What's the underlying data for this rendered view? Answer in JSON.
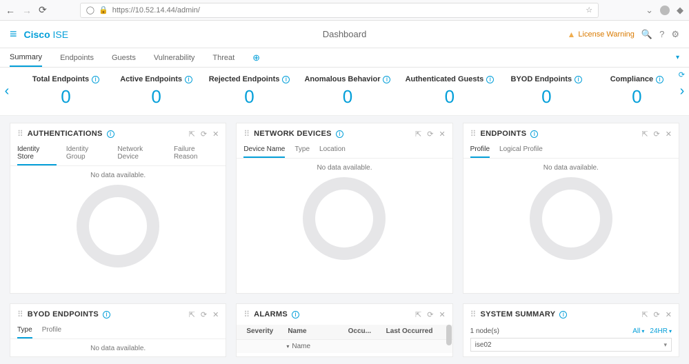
{
  "browser": {
    "url": "https://10.52.14.44/admin/"
  },
  "header": {
    "brand1": "Cisco",
    "brand2": "ISE",
    "title": "Dashboard",
    "license": "License Warning"
  },
  "tabs": {
    "items": [
      "Summary",
      "Endpoints",
      "Guests",
      "Vulnerability",
      "Threat"
    ]
  },
  "metrics": [
    {
      "label": "Total Endpoints",
      "value": "0"
    },
    {
      "label": "Active Endpoints",
      "value": "0"
    },
    {
      "label": "Rejected Endpoints",
      "value": "0"
    },
    {
      "label": "Anomalous Behavior",
      "value": "0"
    },
    {
      "label": "Authenticated Guests",
      "value": "0"
    },
    {
      "label": "BYOD Endpoints",
      "value": "0"
    },
    {
      "label": "Compliance",
      "value": "0"
    }
  ],
  "cards": {
    "auth": {
      "title": "AUTHENTICATIONS",
      "subtabs": [
        "Identity Store",
        "Identity Group",
        "Network Device",
        "Failure Reason"
      ],
      "no_data": "No data available."
    },
    "netdev": {
      "title": "NETWORK DEVICES",
      "subtabs": [
        "Device Name",
        "Type",
        "Location"
      ],
      "no_data": "No data available."
    },
    "endp": {
      "title": "ENDPOINTS",
      "subtabs": [
        "Profile",
        "Logical Profile"
      ],
      "no_data": "No data available."
    },
    "byod": {
      "title": "BYOD ENDPOINTS",
      "subtabs": [
        "Type",
        "Profile"
      ],
      "no_data": "No data available."
    },
    "alarms": {
      "title": "ALARMS",
      "cols": {
        "sev": "Severity",
        "name": "Name",
        "occ": "Occu...",
        "last": "Last Occurred"
      },
      "row_name": "Name"
    },
    "syssum": {
      "title": "SYSTEM SUMMARY",
      "nodes": "1 node(s)",
      "all": "All",
      "range": "24HR",
      "selected": "ise02"
    }
  }
}
